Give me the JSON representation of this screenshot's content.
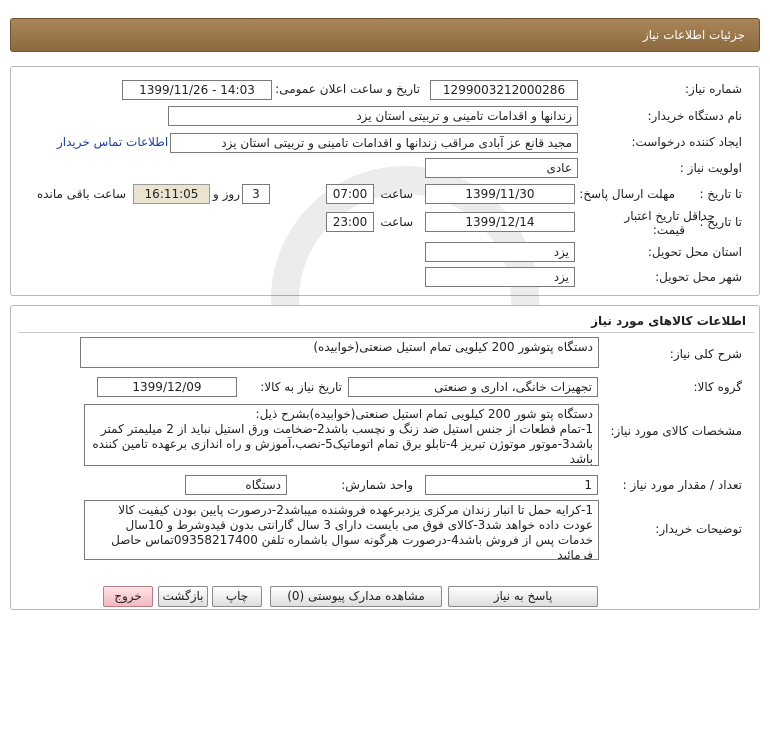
{
  "header": {
    "title": "جزئیات اطلاعات نیاز"
  },
  "details": {
    "need_number_label": "شماره نیاز:",
    "need_number": "1299003212000286",
    "announce_label": "تاریخ و ساعت اعلان عمومی:",
    "announce_value": "1399/11/26 - 14:03",
    "buyer_org_label": "نام دستگاه خریدار:",
    "buyer_org": "زندانها و اقدامات تامینی و تربیتی استان یزد",
    "creator_label": "ایجاد کننده درخواست:",
    "creator": "مجید قانع عز آبادی  مراقب زندانها و اقدامات تامینی و تربیتی استان یزد",
    "contact_link": "اطلاعات تماس خریدار",
    "priority_label": "اولویت نیاز :",
    "priority": "عادی",
    "deadline_label": "مهلت ارسال پاسخ:",
    "to_date_label": "تا تاریخ :",
    "deadline_date": "1399/11/30",
    "time_label": "ساعت",
    "deadline_time": "07:00",
    "days_value": "3",
    "days_label": "روز و",
    "remaining_time": "16:11:05",
    "remaining_label": "ساعت باقی مانده",
    "min_validity_label_1": "حداقل تاریخ اعتبار",
    "min_validity_label_2": "قیمت:",
    "validity_to_label": "تا تاریخ :",
    "validity_date": "1399/12/14",
    "validity_time_label": "ساعت",
    "validity_time": "23:00",
    "province_label": "استان محل تحویل:",
    "province": "یزد",
    "city_label": "شهر محل تحویل:",
    "city": "یزد"
  },
  "goods": {
    "title": "اطلاعات کالاهای مورد نیاز",
    "general_desc_label": "شرح کلی نیاز:",
    "general_desc": "دستگاه پتوشور 200 کیلویی تمام استیل صنعتی(خوابیده)",
    "group_label": "گروه کالا:",
    "group": "تجهیزات خانگی، اداری و صنعتی",
    "need_date_label": "تاریخ نیاز به کالا:",
    "need_date": "1399/12/09",
    "specs_label": "مشخصات کالای مورد نیاز:",
    "specs": "دستگاه پتو شور 200 کیلویی تمام استیل صنعتی(خوابیده)بشرح ذیل:\n1-تمام قطعات از جنس استیل ضد زنگ و نچسب باشد2-ضخامت ورق استیل نباید از 2 میلیمتر کمتر باشد3-موتور موتوژن تبریز 4-تابلو برق تمام اتوماتیک5-نصب،آموزش و راه اندازی برعهده تامین کننده باشد",
    "quantity_label": "تعداد / مقدار مورد نیاز :",
    "quantity": "1",
    "unit_label": "واحد شمارش:",
    "unit": "دستگاه",
    "buyer_notes_label": "توضیحات خریدار:",
    "buyer_notes": "1-کرایه حمل تا انبار زندان مرکزی یزدبرعهده فروشنده میباشد2-درصورت پایین بودن کیفیت کالا عودت داده خواهد شد3-کالای فوق می بایست دارای 3 سال گارانتی بدون قیدوشرط و 10سال خدمات پس از فروش باشد4-درصورت هرگونه سوال باشماره تلفن 09358217400تماس حاصل فرمائید"
  },
  "buttons": {
    "reply": "پاسخ به نیاز",
    "attachments": "مشاهده مدارک پیوستی (0)",
    "print": "چاپ",
    "back": "بازگشت",
    "exit": "خروج"
  },
  "colors": {
    "header_bg": "#9a774a",
    "link": "#1d3fae",
    "remaining_bg": "#e9e3cf",
    "exit_bg": "#f3b9bf"
  }
}
